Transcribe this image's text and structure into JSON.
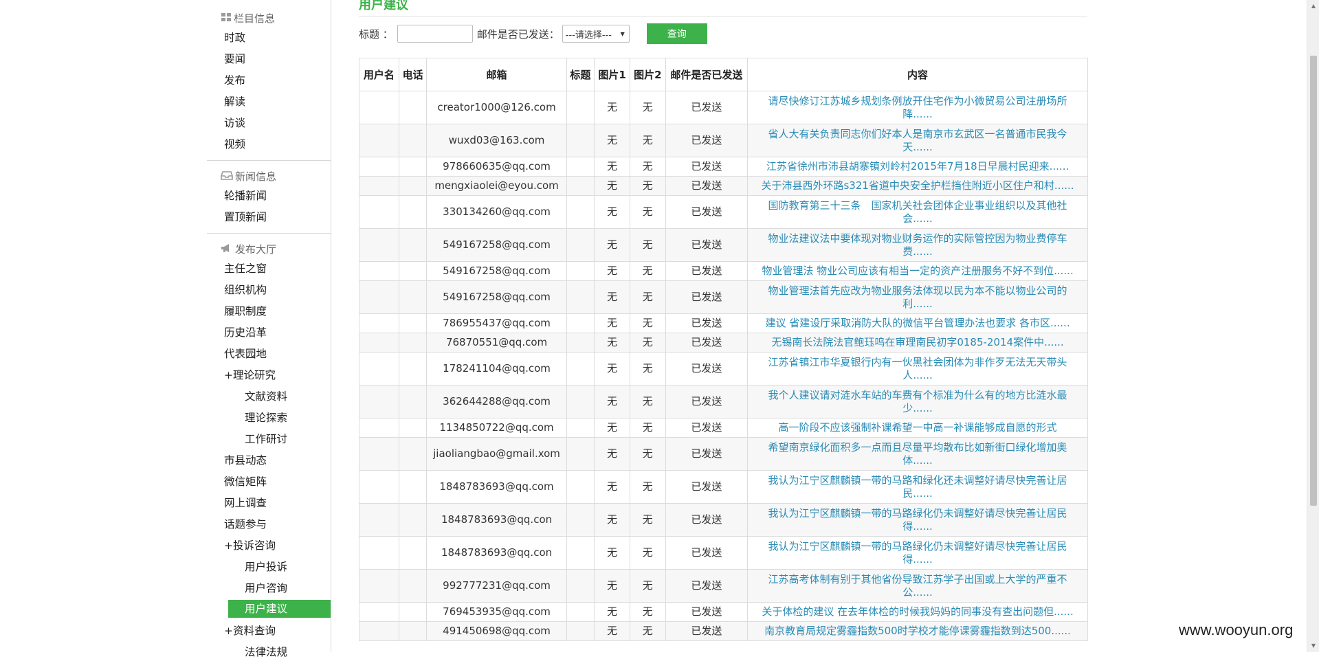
{
  "sidebar": {
    "sections": [
      {
        "title": "栏目信息",
        "icon": "grid-icon",
        "items": [
          "时政",
          "要闻",
          "发布",
          "解读",
          "访谈",
          "视频"
        ]
      },
      {
        "title": "新闻信息",
        "icon": "inbox-icon",
        "items": [
          "轮播新闻",
          "置顶新闻"
        ]
      },
      {
        "title": "发布大厅",
        "icon": "megaphone-icon",
        "items": [
          "主任之窗",
          "组织机构",
          "履职制度",
          "历史沿革",
          "代表园地",
          "+理论研究",
          "文献资料",
          "理论探索",
          "工作研讨",
          "市县动态",
          "微信矩阵",
          "网上调查",
          "话题参与",
          "+投诉咨询",
          "用户投诉",
          "用户咨询",
          "用户建议",
          "+资料查询",
          "法律法规"
        ]
      }
    ]
  },
  "page": {
    "title": "用户建议"
  },
  "filter": {
    "title_label": "标题 ：",
    "title_value": "",
    "sent_label": "邮件是否已发送：",
    "sent_value": "---请选择---",
    "query_label": "查询"
  },
  "table": {
    "headers": [
      "用户名",
      "电话",
      "邮箱",
      "标题",
      "图片1",
      "图片2",
      "邮件是否已发送",
      "内容"
    ],
    "rows": [
      {
        "user": "",
        "phone": "",
        "email": "creator1000@126.com",
        "title": "",
        "img1": "无",
        "img2": "无",
        "sent": "已发送",
        "content": "请尽快修订江苏城乡规划条例放开住宅作为小微贸易公司注册场所降......"
      },
      {
        "user": "",
        "phone": "",
        "email": "wuxd03@163.com",
        "title": "",
        "img1": "无",
        "img2": "无",
        "sent": "已发送",
        "content": "省人大有关负责同志你们好本人是南京市玄武区一名普通市民我今天......"
      },
      {
        "user": "",
        "phone": "",
        "email": "978660635@qq.com",
        "title": "",
        "img1": "无",
        "img2": "无",
        "sent": "已发送",
        "content": "江苏省徐州市沛县胡寨镇刘岭村2015年7月18日早晨村民迎来......"
      },
      {
        "user": "",
        "phone": "",
        "email": "mengxiaolei@eyou.com",
        "title": "",
        "img1": "无",
        "img2": "无",
        "sent": "已发送",
        "content": "关于沛县西外环路s321省道中央安全护栏挡住附近小区住户和村......"
      },
      {
        "user": "",
        "phone": "",
        "email": "330134260@qq.com",
        "title": "",
        "img1": "无",
        "img2": "无",
        "sent": "已发送",
        "content": "国防教育第三十三条　国家机关社会团体企业事业组织以及其他社会......"
      },
      {
        "user": "",
        "phone": "",
        "email": "549167258@qq.com",
        "title": "",
        "img1": "无",
        "img2": "无",
        "sent": "已发送",
        "content": "物业法建议法中要体现对物业财务运作的实际管控因为物业费停车费......"
      },
      {
        "user": "",
        "phone": "",
        "email": "549167258@qq.com",
        "title": "",
        "img1": "无",
        "img2": "无",
        "sent": "已发送",
        "content": "物业管理法 物业公司应该有相当一定的资产注册服务不好不到位......"
      },
      {
        "user": "",
        "phone": "",
        "email": "549167258@qq.com",
        "title": "",
        "img1": "无",
        "img2": "无",
        "sent": "已发送",
        "content": "物业管理法首先应改为物业服务法体现以民为本不能以物业公司的利......"
      },
      {
        "user": "",
        "phone": "",
        "email": "786955437@qq.com",
        "title": "",
        "img1": "无",
        "img2": "无",
        "sent": "已发送",
        "content": "建议 省建设厅采取消防大队的微信平台管理办法也要求 各市区......"
      },
      {
        "user": "",
        "phone": "",
        "email": "76870551@qq.com",
        "title": "",
        "img1": "无",
        "img2": "无",
        "sent": "已发送",
        "content": "无锡南长法院法官鲍珏呜在审理南民初字0185-2014案件中......"
      },
      {
        "user": "",
        "phone": "",
        "email": "178241104@qq.com",
        "title": "",
        "img1": "无",
        "img2": "无",
        "sent": "已发送",
        "content": "江苏省镇江市华夏银行内有一伙黑社会团体为非作歹无法无天带头人......"
      },
      {
        "user": "",
        "phone": "",
        "email": "362644288@qq.com",
        "title": "",
        "img1": "无",
        "img2": "无",
        "sent": "已发送",
        "content": "我个人建议请对涟水车站的车费有个标准为什么有的地方比涟水最少......"
      },
      {
        "user": "",
        "phone": "",
        "email": "1134850722@qq.com",
        "title": "",
        "img1": "无",
        "img2": "无",
        "sent": "已发送",
        "content": "高一阶段不应该强制补课希望一中高一补课能够成自愿的形式"
      },
      {
        "user": "",
        "phone": "",
        "email": "jiaoliangbao@gmail.xom",
        "title": "",
        "img1": "无",
        "img2": "无",
        "sent": "已发送",
        "content": "希望南京绿化面积多一点而且尽量平均散布比如新街口绿化增加奥体......"
      },
      {
        "user": "",
        "phone": "",
        "email": "1848783693@qq.com",
        "title": "",
        "img1": "无",
        "img2": "无",
        "sent": "已发送",
        "content": "我认为江宁区麒麟镇一带的马路和绿化还未调整好请尽快完善让居民......"
      },
      {
        "user": "",
        "phone": "",
        "email": "1848783693@qq.con",
        "title": "",
        "img1": "无",
        "img2": "无",
        "sent": "已发送",
        "content": "我认为江宁区麒麟镇一带的马路绿化仍未调整好请尽快完善让居民得......"
      },
      {
        "user": "",
        "phone": "",
        "email": "1848783693@qq.con",
        "title": "",
        "img1": "无",
        "img2": "无",
        "sent": "已发送",
        "content": "我认为江宁区麒麟镇一带的马路绿化仍未调整好请尽快完善让居民得......"
      },
      {
        "user": "",
        "phone": "",
        "email": "992777231@qq.com",
        "title": "",
        "img1": "无",
        "img2": "无",
        "sent": "已发送",
        "content": "江苏高考体制有别于其他省份导致江苏学子出国或上大学的严重不公......"
      },
      {
        "user": "",
        "phone": "",
        "email": "769453935@qq.com",
        "title": "",
        "img1": "无",
        "img2": "无",
        "sent": "已发送",
        "content": "关于体检的建议 在去年体检的时候我妈妈的同事没有查出问题但......"
      },
      {
        "user": "",
        "phone": "",
        "email": "491450698@qq.com",
        "title": "",
        "img1": "无",
        "img2": "无",
        "sent": "已发送",
        "content": "南京教育局规定雾霾指数500时学校才能停课雾霾指数到达500......"
      }
    ]
  },
  "watermark": "www.wooyun.org",
  "colors": {
    "accent": "#3db24a",
    "link": "#2a8bb5"
  }
}
